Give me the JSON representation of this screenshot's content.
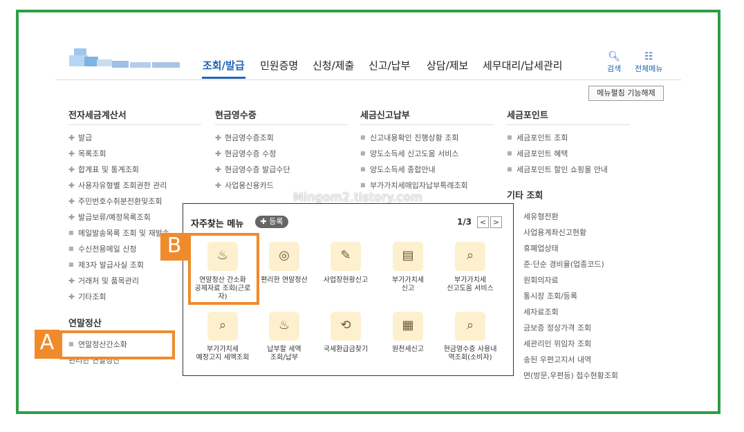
{
  "nav": {
    "items": [
      "조회/발급",
      "민원증명",
      "신청/제출",
      "신고/납부",
      "상담/제보",
      "세무대리/납세관리"
    ],
    "active_index": 0
  },
  "header": {
    "search_label": "검색",
    "menu_label": "전체메뉴",
    "toggle_button": "메뉴펼침 기능해제"
  },
  "columns": {
    "c1": {
      "title": "전자세금계산서",
      "items": [
        "발급",
        "목록조회",
        "합계표 및 통계조회",
        "사용자유형별 조회권한 관리",
        "주민번호수취분전환및조회",
        "발급보류/예정목록조회",
        "메일발송목록 조회 및 재발송",
        "수신전용메일 신청",
        "제3자 발급사실 조회",
        "거래처 및 품목관리",
        "기타조회"
      ]
    },
    "c1b": {
      "title": "연말정산",
      "items": [
        "연말정산간소화",
        "편리한 연말정산"
      ]
    },
    "c2": {
      "title": "현금영수증",
      "items": [
        "현금영수증조회",
        "현금영수증 수정",
        "현금영수증 발급수단",
        "사업용신용카드"
      ]
    },
    "c3": {
      "title": "세금신고납부",
      "items": [
        "신고내용확인 진행상황 조회",
        "양도소득세 신고도움 서비스",
        "양도소득세 종합안내",
        "부가가치세매입자납부특례조회"
      ]
    },
    "c4": {
      "title": "세금포인트",
      "items": [
        "세금포인트 조회",
        "세금포인트 혜택",
        "세금포인트 할인 쇼핑몰 안내"
      ]
    },
    "c4b": {
      "title": "기타 조회",
      "items": [
        "세유형전환",
        "사업용계좌신고현황",
        "휴폐업상태",
        "준·단순 경비율(업종코드)",
        "원회의자료",
        "통시장 조회/등록",
        "세자료조회",
        "금보증 정상가격 조회",
        "세관리인 위임자 조회",
        "송된 우편고지서 내역",
        "면(방문,우편등) 접수현황조회"
      ]
    }
  },
  "watermark": "Mingom2.tistory.com",
  "popup": {
    "title": "자주찾는 메뉴",
    "register": "등록",
    "page": "1/3",
    "prev": "<",
    "next": ">",
    "tiles": [
      {
        "icon": "money-bag-icon",
        "glyph": "♨",
        "lines": [
          "연말정산 간소화",
          "공제자료 조회(근로",
          "자)"
        ]
      },
      {
        "icon": "coins-icon",
        "glyph": "◎",
        "lines": [
          "편리한 연말정산"
        ]
      },
      {
        "icon": "document-pen-icon",
        "glyph": "✎",
        "lines": [
          "사업장현황신고"
        ]
      },
      {
        "icon": "vat-pen-icon",
        "glyph": "▤",
        "lines": [
          "부가가치세",
          "신고"
        ]
      },
      {
        "icon": "vat-search-icon",
        "glyph": "⌕",
        "lines": [
          "부가가치세",
          "신고도움 서비스"
        ]
      },
      {
        "icon": "notice-search-icon",
        "glyph": "⌕",
        "lines": [
          "부가가치세",
          "예정고지 세액조회"
        ]
      },
      {
        "icon": "money-bag-icon",
        "glyph": "♨",
        "lines": [
          "납부할 세액",
          "조회/납부"
        ]
      },
      {
        "icon": "refund-coin-icon",
        "glyph": "⟲",
        "lines": [
          "국세환급금찾기"
        ]
      },
      {
        "icon": "calendar-pen-icon",
        "glyph": "▦",
        "lines": [
          "원천세신고"
        ]
      },
      {
        "icon": "receipt-search-icon",
        "glyph": "⌕",
        "lines": [
          "현금영수증 사용내",
          "역조회(소비자)"
        ]
      }
    ]
  },
  "annotations": {
    "a": "A",
    "b": "B"
  },
  "colors": {
    "accent": "#1f63b5",
    "highlight": "#f08a2b",
    "frame": "#2e9e46"
  }
}
